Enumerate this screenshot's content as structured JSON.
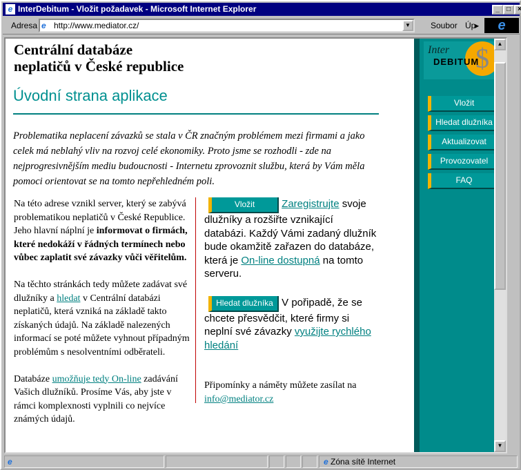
{
  "window": {
    "title": "InterDebitum - Vložit požadavek - Microsoft Internet Explorer"
  },
  "addressbar": {
    "label": "Adresa",
    "url": "http://www.mediator.cz/",
    "menu_file": "Soubor",
    "menu_edit": "Úp"
  },
  "page": {
    "heading_line1": "Centrální databáze",
    "heading_line2": "neplatičů v České republice",
    "subtitle": "Úvodní strana aplikace",
    "intro": "Problematika neplacení závazků se stala v ČR značným problémem mezi firmami a jako celek má neblahý vliv na rozvoj celé ekonomiky. Proto jsme se rozhodli - zde na nejprogresivnějším mediu budoucnosti - Internetu zprovoznit službu, která by Vám měla pomoci orientovat se na tomto nepřehledném poli.",
    "left": {
      "p1_a": "Na této adrese vznikl server, který se zabývá problematikou neplatičů v České Republice. Jeho hlavní náplní je ",
      "p1_bold": "informovat o firmách, které nedokáží v řádných termínech nebo vůbec zaplatit své závazky vůči věřitelům.",
      "p2_a": "Na těchto stránkách tedy můžete zadávat své dlužníky a ",
      "p2_link": "hledat",
      "p2_b": " v Centrální databázi neplatičů, která vzniká na základě takto získaných údajů. Na základě nalezených informací se poté můžete vyhnout případným problémům s nesolventními odběrateli.",
      "p3_a": "Databáze ",
      "p3_link": "umožňuje tedy On-line",
      "p3_b": " zadávání Vašich dlužníků. Prosíme Vás, aby jste v rámci komplexnosti vyplnili co nejvíce známých údajů."
    },
    "right": {
      "btn1": "Vložit",
      "r1_link": "Zaregistrujte",
      "r1_a": " svoje dlužníky a rozšiřte vznikající databázi. Každý Vámi zadaný dlužník bude okamžitě zařazen do databáze, která je ",
      "r1_link2": "On-line dostupná",
      "r1_b": " na tomto serveru.",
      "btn2": "Hledat dlužníka",
      "r2_a": " V pořipadě, že se chcete přesvědčit, které firmy si neplní své závazky ",
      "r2_link": "využijte rychlého hledání",
      "contact_text": "Připomínky a náměty můžete zasílat na ",
      "contact_email": "info@mediator.cz"
    }
  },
  "sidebar": {
    "logo_text_1": "Inter",
    "logo_text_2": "DEBITUM",
    "nav": [
      "Vložit",
      "Hledat dlužníka",
      "Aktualizovat",
      "Provozovatel",
      "FAQ"
    ]
  },
  "status": {
    "zone": "Zóna sítě Internet"
  }
}
